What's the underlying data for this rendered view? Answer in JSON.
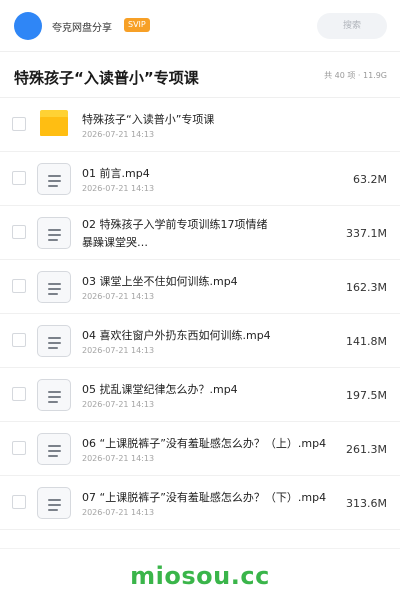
{
  "header": {
    "username": "夸克网盘分享",
    "badge": "SVIP",
    "search_placeholder": "搜索",
    "accent_color": "#2f86f6",
    "badge_color": "#f7a026"
  },
  "folder": {
    "title": "特殊孩子“入读普小”专项课",
    "summary": "共 40 项 · 11.9G"
  },
  "items": [
    {
      "icon": "folder-icon",
      "name": "特殊孩子“入读普小”专项课",
      "date": "2026-07-21 14:13",
      "size": ""
    },
    {
      "icon": "file-icon",
      "name": "01 前言.mp4",
      "date": "2026-07-21 14:13",
      "size": "63.2M"
    },
    {
      "icon": "file-icon",
      "name": "02 特殊孩子入学前专项训练17项情绪暴躁课堂哭…",
      "date": "",
      "size": "337.1M"
    },
    {
      "icon": "file-icon",
      "name": "03 课堂上坐不住如何训练.mp4",
      "date": "2026-07-21 14:13",
      "size": "162.3M"
    },
    {
      "icon": "file-icon",
      "name": "04 喜欢往窗户外扔东西如何训练.mp4",
      "date": "2026-07-21 14:13",
      "size": "141.8M"
    },
    {
      "icon": "file-icon",
      "name": "05 扰乱课堂纪律怎么办？.mp4",
      "date": "2026-07-21 14:13",
      "size": "197.5M"
    },
    {
      "icon": "file-icon",
      "name": "06 “上课脱裤子”没有羞耻感怎么办？（上）.mp4",
      "date": "2026-07-21 14:13",
      "size": "261.3M"
    },
    {
      "icon": "file-icon",
      "name": "07 “上课脱裤子”没有羞耻感怎么办？（下）.mp4",
      "date": "2026-07-21 14:13",
      "size": "313.6M"
    }
  ],
  "watermark": "miosou.cc"
}
